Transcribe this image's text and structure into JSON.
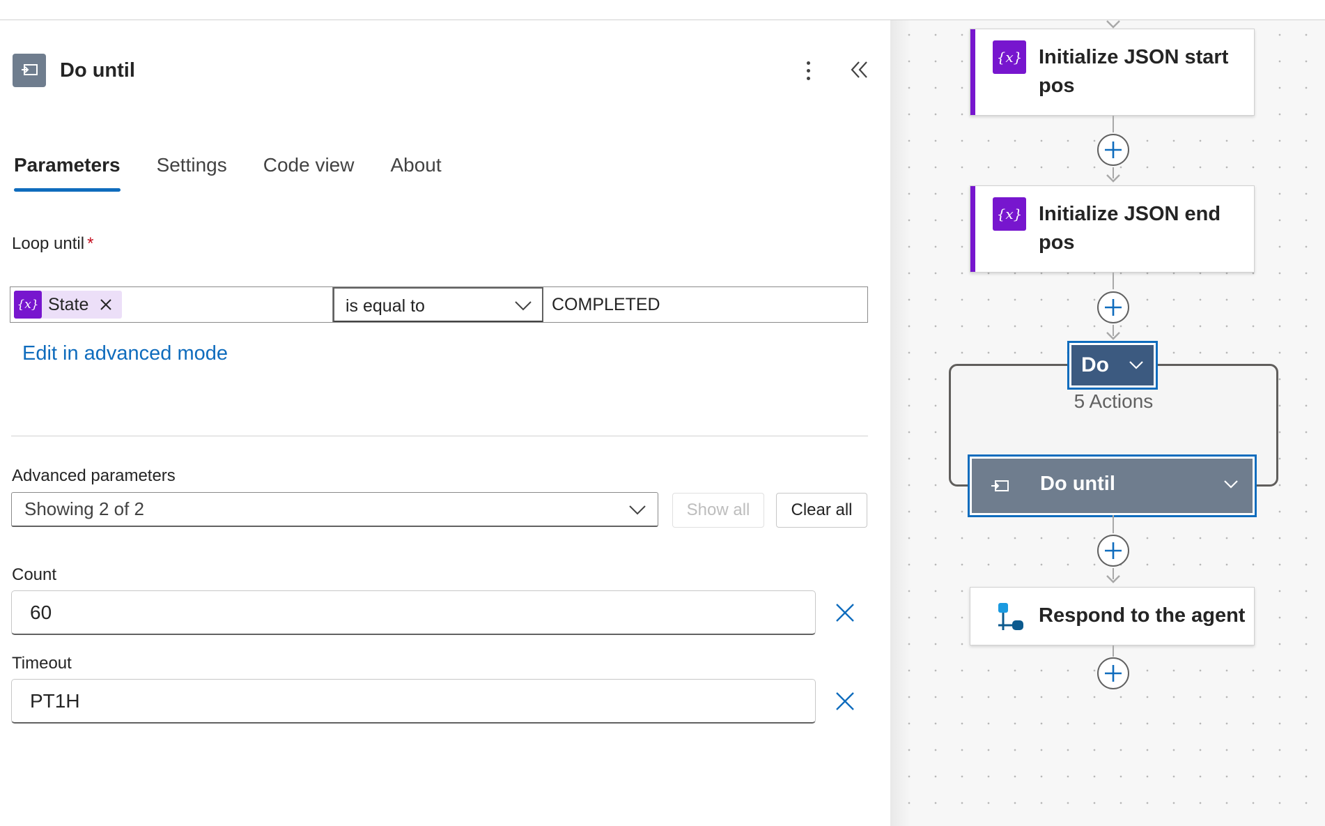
{
  "panel": {
    "title": "Do until",
    "tabs": [
      {
        "label": "Parameters",
        "active": true
      },
      {
        "label": "Settings",
        "active": false
      },
      {
        "label": "Code view",
        "active": false
      },
      {
        "label": "About",
        "active": false
      }
    ],
    "loop_until": {
      "label": "Loop until",
      "required_mark": "*",
      "token_icon": "{x}",
      "token_label": "State",
      "operator": "is equal to",
      "value": "COMPLETED"
    },
    "advanced_mode_link": "Edit in advanced mode",
    "advanced_parameters": {
      "label": "Advanced parameters",
      "selected": "Showing 2 of 2",
      "show_all": "Show all",
      "clear_all": "Clear all"
    },
    "count": {
      "label": "Count",
      "value": "60"
    },
    "timeout": {
      "label": "Timeout",
      "value": "PT1H"
    }
  },
  "canvas": {
    "nodes": [
      {
        "title": "Initialize JSON start pos",
        "icon": "{x}"
      },
      {
        "title": "Initialize JSON end pos",
        "icon": "{x}"
      }
    ],
    "scope": {
      "label": "Do",
      "subtitle": "5 Actions"
    },
    "do_until_node": {
      "title": "Do until"
    },
    "respond_node": {
      "title": "Respond to the agent"
    }
  },
  "colors": {
    "accent": "#0f6cbd",
    "variable_purple": "#7716ce",
    "control_gray": "#6f7d8e",
    "scope_blue": "#3c5a80"
  },
  "icons": {
    "panel_action": "loop-icon",
    "more": "more-vertical-icon",
    "collapse": "double-chevron-left-icon",
    "add": "plus-circle-icon",
    "clear": "close-icon",
    "respond": "agent-flow-icon"
  }
}
